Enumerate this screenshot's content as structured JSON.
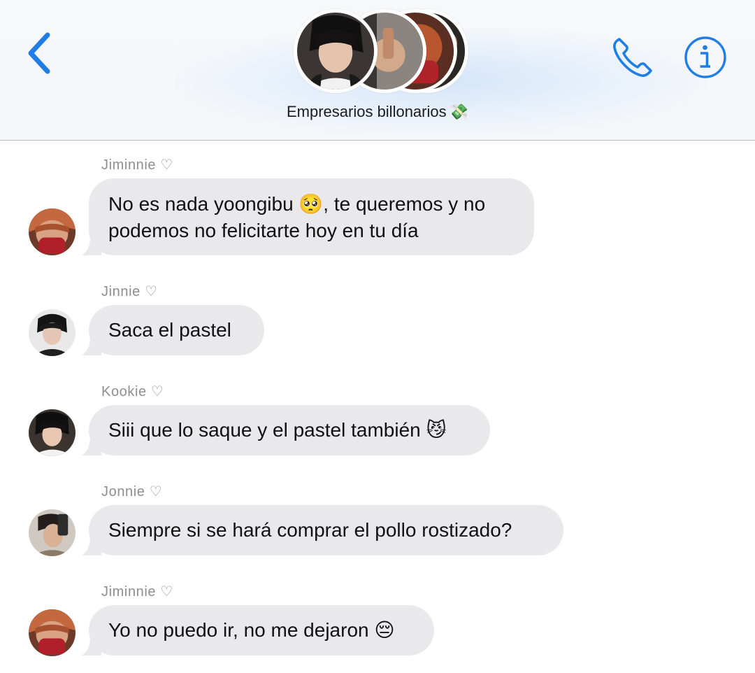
{
  "header": {
    "title": "Empresarios billonarios",
    "title_emoji": "💸",
    "back_icon": "chevron-left-icon",
    "call_icon": "phone-icon",
    "info_icon": "info-icon"
  },
  "colors": {
    "accent": "#1f7ee6",
    "bubble_bg": "#e9e9eb",
    "sender_text": "#8e8e93",
    "message_text": "#111111"
  },
  "messages": [
    {
      "sender": "Jiminnie ♡",
      "text": "No es nada yoongibu 🥺, te queremos y no\npodemos no felicitarte hoy en tu día"
    },
    {
      "sender": "Jinnie ♡",
      "text": "Saca el pastel"
    },
    {
      "sender": "Kookie ♡",
      "text": "Siii que lo saque y el pastel también 😼"
    },
    {
      "sender": "Jonnie ♡",
      "text": "Siempre si se hará comprar el pollo rostizado?"
    },
    {
      "sender": "Jiminnie ♡",
      "text": "Yo no puedo ir, no me dejaron 😔"
    }
  ]
}
